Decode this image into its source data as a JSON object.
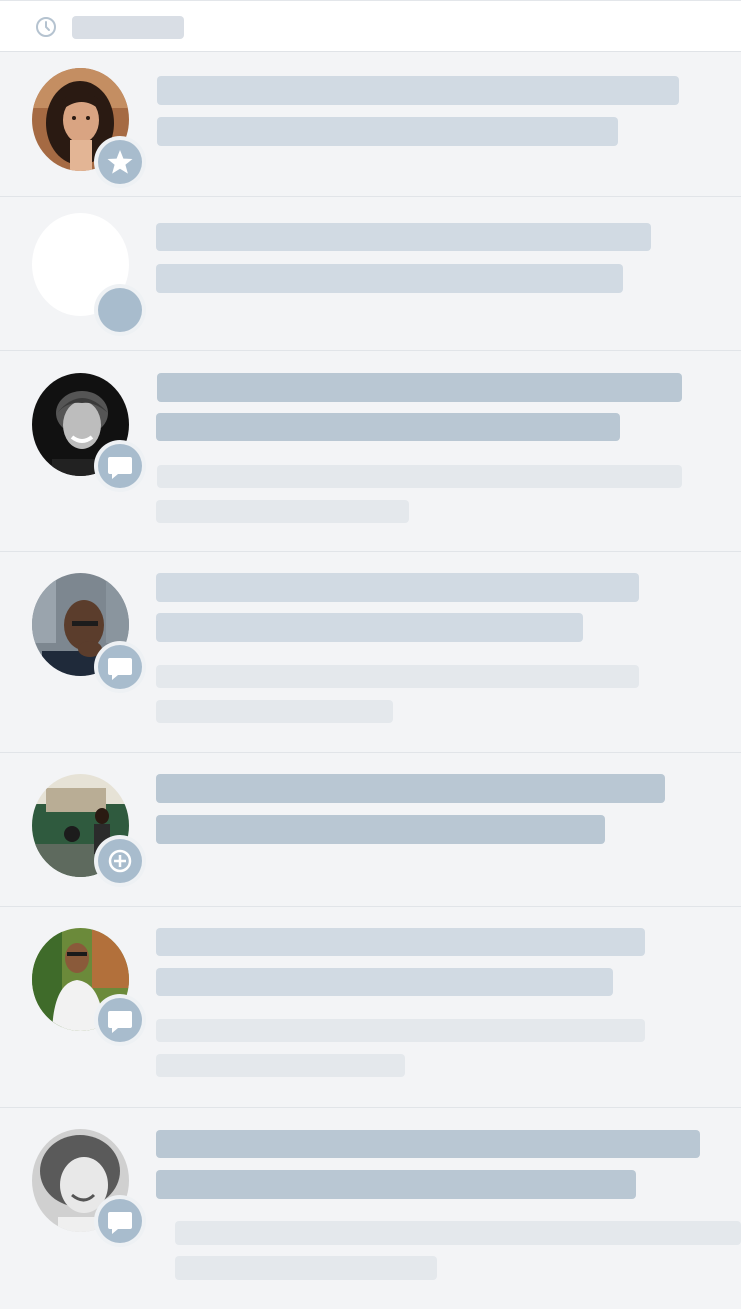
{
  "app": {
    "header": {
      "icon": "clock-icon"
    }
  },
  "colors": {
    "background": "#f3f4f6",
    "placeholder_primary": "#d1dae3",
    "placeholder_strong": "#b9c7d3",
    "placeholder_secondary": "#e4e8ec",
    "badge": "#a8bccd"
  },
  "activity_items": [
    {
      "avatar": "photo-woman-dark-hair",
      "badge_icon": "star-icon",
      "loaded": false,
      "detail_lines": 0
    },
    {
      "avatar": "empty-avatar",
      "badge_icon": "none",
      "loaded": false,
      "detail_lines": 0
    },
    {
      "avatar": "photo-man-curly-hair-bw",
      "badge_icon": "comment-icon",
      "loaded": true,
      "detail_lines": 2
    },
    {
      "avatar": "photo-bald-man-glasses",
      "badge_icon": "comment-icon",
      "loaded": false,
      "detail_lines": 2
    },
    {
      "avatar": "photo-woman-outdoors",
      "badge_icon": "plus-circle-icon",
      "loaded": true,
      "detail_lines": 0
    },
    {
      "avatar": "photo-man-sunglasses",
      "badge_icon": "comment-icon",
      "loaded": false,
      "detail_lines": 2
    },
    {
      "avatar": "photo-woman-curly-hair-bw",
      "badge_icon": "comment-icon",
      "loaded": true,
      "detail_lines": 2
    }
  ]
}
